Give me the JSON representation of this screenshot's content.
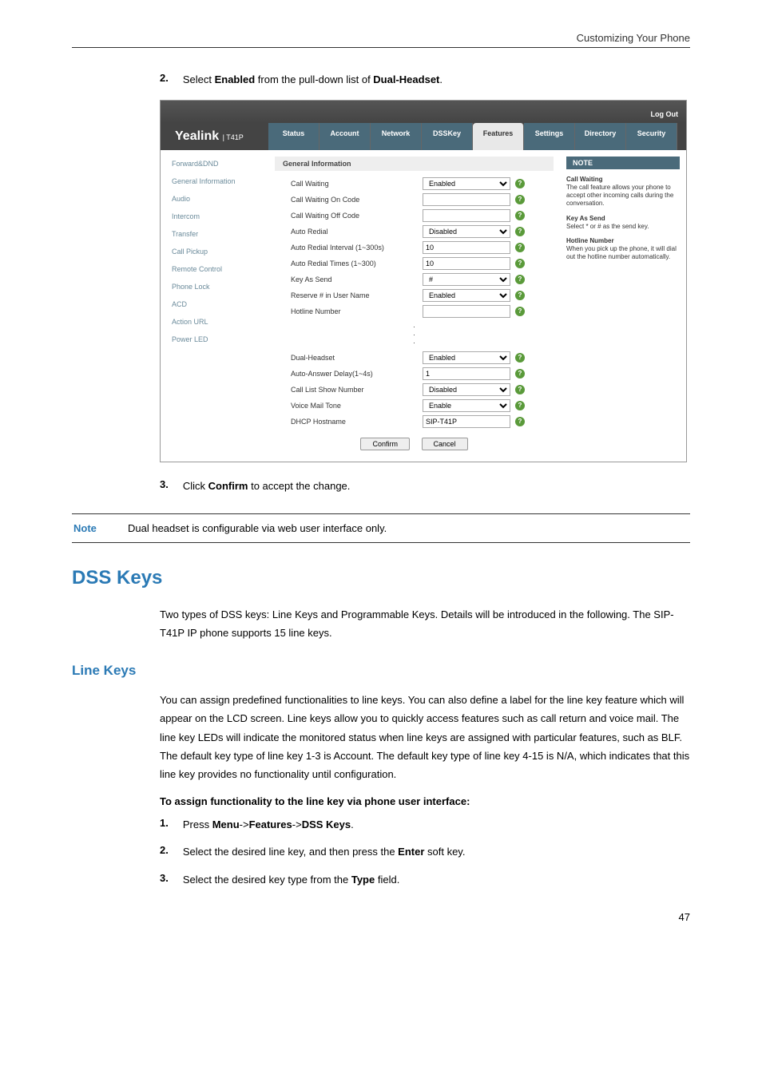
{
  "header": {
    "right": "Customizing Your Phone"
  },
  "step2": {
    "num": "2.",
    "pre": "Select ",
    "b1": "Enabled",
    "mid": " from the pull-down list of ",
    "b2": "Dual-Headset",
    "post": "."
  },
  "webui": {
    "logout": "Log Out",
    "logo": "Yealink",
    "logo_sub": "T41P",
    "tabs": [
      "Status",
      "Account",
      "Network",
      "DSSKey",
      "Features",
      "Settings",
      "Directory",
      "Security"
    ],
    "sidebar": [
      "Forward&DND",
      "General Information",
      "Audio",
      "Intercom",
      "Transfer",
      "Call Pickup",
      "Remote Control",
      "Phone Lock",
      "ACD",
      "Action URL",
      "Power LED"
    ],
    "section_title": "General Information",
    "rows1": [
      {
        "label": "Call Waiting",
        "type": "select",
        "value": "Enabled"
      },
      {
        "label": "Call Waiting On Code",
        "type": "text",
        "value": ""
      },
      {
        "label": "Call Waiting Off Code",
        "type": "text",
        "value": ""
      },
      {
        "label": "Auto Redial",
        "type": "select",
        "value": "Disabled"
      },
      {
        "label": "Auto Redial Interval (1~300s)",
        "type": "text",
        "value": "10"
      },
      {
        "label": "Auto Redial Times (1~300)",
        "type": "text",
        "value": "10"
      },
      {
        "label": "Key As Send",
        "type": "select",
        "value": "#"
      },
      {
        "label": "Reserve # in User Name",
        "type": "select",
        "value": "Enabled"
      },
      {
        "label": "Hotline Number",
        "type": "text",
        "value": ""
      }
    ],
    "rows2": [
      {
        "label": "Dual-Headset",
        "type": "select",
        "value": "Enabled"
      },
      {
        "label": "Auto-Answer Delay(1~4s)",
        "type": "text",
        "value": "1"
      },
      {
        "label": "Call List Show Number",
        "type": "select",
        "value": "Disabled"
      },
      {
        "label": "Voice Mail Tone",
        "type": "select",
        "value": "Enable"
      },
      {
        "label": "DHCP Hostname",
        "type": "text",
        "value": "SIP-T41P"
      }
    ],
    "buttons": {
      "confirm": "Confirm",
      "cancel": "Cancel"
    },
    "notes": {
      "header": "NOTE",
      "blocks": [
        {
          "title": "Call Waiting",
          "body": "The call feature allows your phone to accept other incoming calls during the conversation."
        },
        {
          "title": "Key As Send",
          "body": "Select * or # as the send key."
        },
        {
          "title": "Hotline Number",
          "body": "When you pick up the phone, it will dial out the hotline number automatically."
        }
      ]
    }
  },
  "step3": {
    "num": "3.",
    "pre": "Click ",
    "b1": "Confirm",
    "post": " to accept the change."
  },
  "note": {
    "label": "Note",
    "text": "Dual headset is configurable via web user interface only."
  },
  "h2": "DSS Keys",
  "p1": "Two types of DSS keys: Line Keys and Programmable Keys. Details will be introduced in the following. The SIP-T41P IP phone supports 15 line keys.",
  "h3": "Line Keys",
  "p2": "You can assign predefined functionalities to line keys. You can also define a label for the line key feature which will appear on the LCD screen. Line keys allow you to quickly access features such as call return and voice mail. The line key LEDs will indicate the monitored status when line keys are assigned with particular features, such as BLF. The default key type of line key 1-3 is Account. The default key type of line key 4-15 is N/A, which indicates that this line key provides no functionality until configuration.",
  "boldp": "To assign functionality to the line key via phone user interface:",
  "s1": {
    "num": "1.",
    "pre": "Press ",
    "b1": "Menu",
    "s": "->",
    "b2": "Features",
    "b3": "DSS Keys",
    "post": "."
  },
  "s2": {
    "num": "2.",
    "pre": "Select the desired line key, and then press the ",
    "b1": "Enter",
    "post": " soft key."
  },
  "s3": {
    "num": "3.",
    "pre": "Select the desired key type from the ",
    "b1": "Type",
    "post": " field."
  },
  "page": "47"
}
